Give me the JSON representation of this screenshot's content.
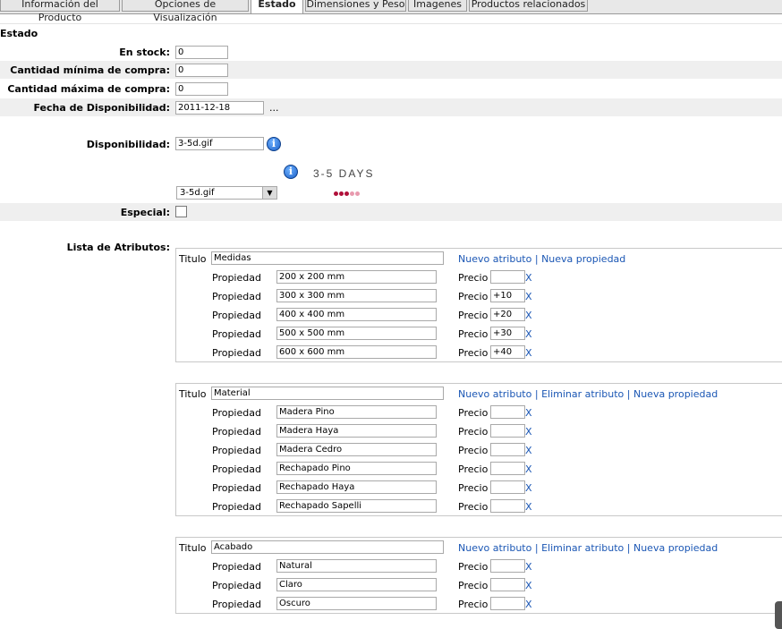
{
  "tabs": [
    {
      "label": "Información del Producto"
    },
    {
      "label": "Opciones de Visualización"
    },
    {
      "label": "Estado"
    },
    {
      "label": "Dimensiones y Peso"
    },
    {
      "label": "Imagenes"
    },
    {
      "label": "Productos relacionados"
    }
  ],
  "section_title": "Estado",
  "fields": {
    "stock": {
      "label": "En stock:",
      "value": "0"
    },
    "min": {
      "label": "Cantidad mínima de compra:",
      "value": "0"
    },
    "max": {
      "label": "Cantidad máxima de compra:",
      "value": "0"
    },
    "fecha": {
      "label": "Fecha de Disponibilidad:",
      "value": "2011-12-18",
      "picker": "..."
    },
    "disp": {
      "label": "Disponibilidad:",
      "value": "3-5d.gif",
      "preview_text": "3-5 DAYS",
      "select_value": "3-5d.gif"
    },
    "especial": {
      "label": "Especial:"
    },
    "attrs_label": "Lista de Atributos:"
  },
  "labels": {
    "titulo": "Titulo",
    "propiedad": "Propiedad",
    "precio": "Precio",
    "delete": "X",
    "nuevo_atributo": "Nuevo atributo",
    "eliminar_atributo": "Eliminar atributo",
    "nueva_propiedad": "Nueva propiedad",
    "sep": "|"
  },
  "attributes": [
    {
      "title": "Medidas",
      "props": [
        {
          "name": "200 x 200 mm",
          "price": ""
        },
        {
          "name": "300 x 300 mm",
          "price": "+10"
        },
        {
          "name": "400 x 400 mm",
          "price": "+20"
        },
        {
          "name": "500 x 500 mm",
          "price": "+30"
        },
        {
          "name": "600 x 600 mm",
          "price": "+40"
        }
      ]
    },
    {
      "title": "Material",
      "props": [
        {
          "name": "Madera Pino",
          "price": ""
        },
        {
          "name": "Madera Haya",
          "price": ""
        },
        {
          "name": "Madera Cedro",
          "price": ""
        },
        {
          "name": "Rechapado Pino",
          "price": ""
        },
        {
          "name": "Rechapado Haya",
          "price": ""
        },
        {
          "name": "Rechapado Sapelli",
          "price": ""
        }
      ]
    },
    {
      "title": "Acabado",
      "props": [
        {
          "name": "Natural",
          "price": ""
        },
        {
          "name": "Claro",
          "price": ""
        },
        {
          "name": "Oscuro",
          "price": ""
        }
      ]
    }
  ],
  "colors": {
    "link": "#1a56b4",
    "dot_dark": "#b0103a",
    "dot_light": "#e89aae"
  }
}
